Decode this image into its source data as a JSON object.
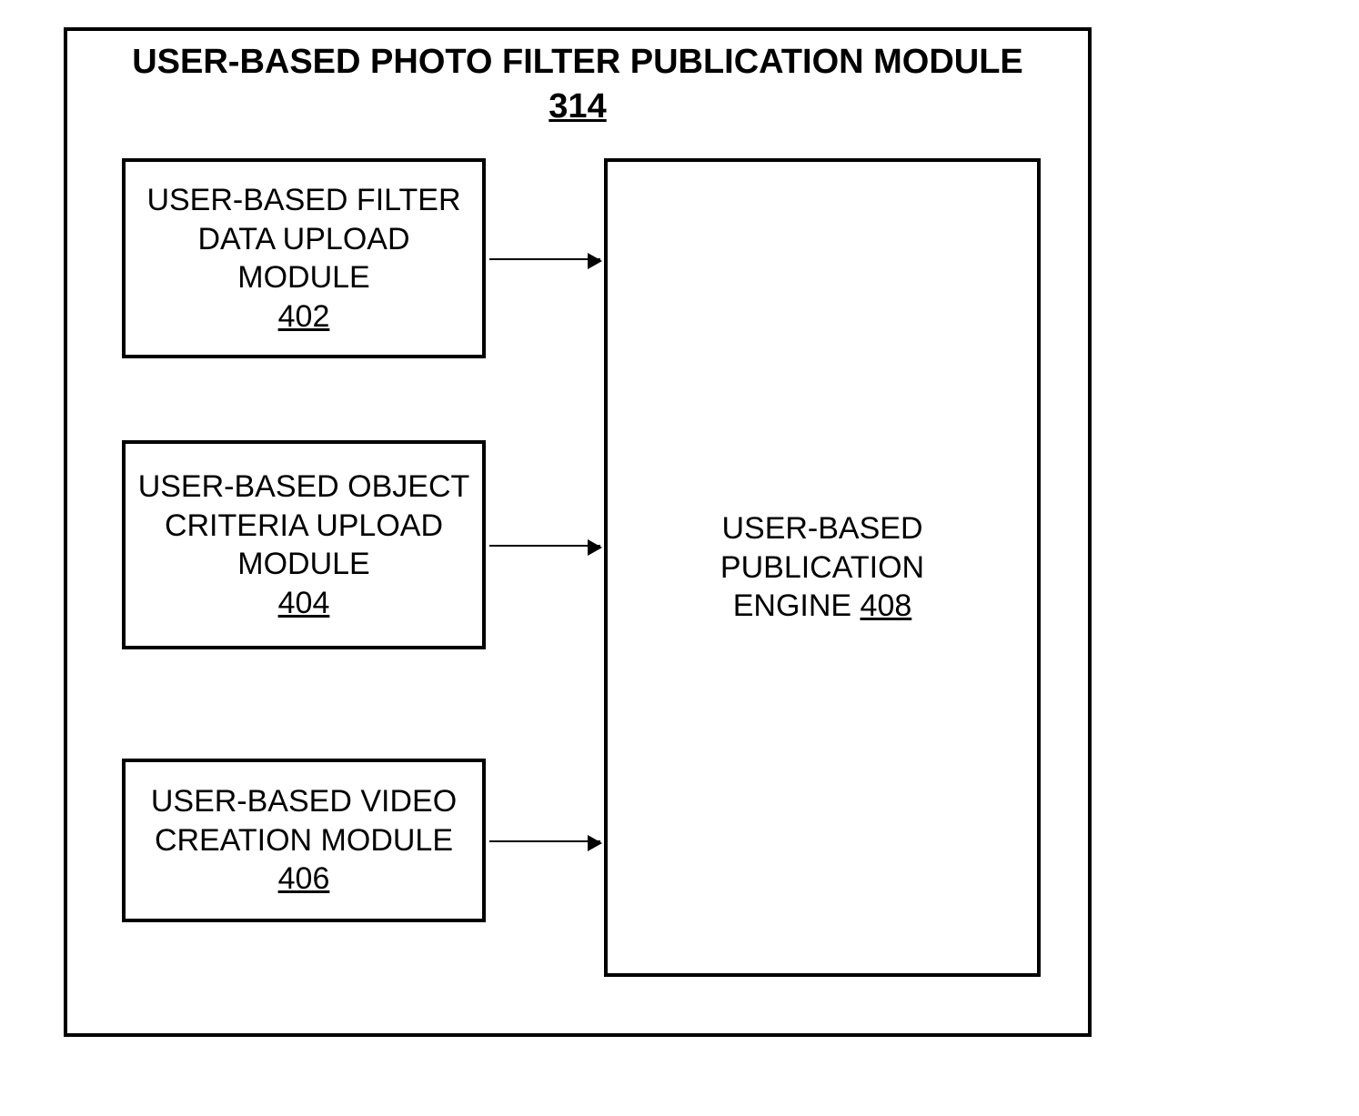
{
  "main": {
    "title": "USER-BASED PHOTO FILTER PUBLICATION MODULE",
    "ref": "314"
  },
  "boxes": {
    "upload_filter": {
      "text": "USER-BASED FILTER DATA UPLOAD MODULE",
      "ref": "402"
    },
    "upload_criteria": {
      "text": "USER-BASED OBJECT CRITERIA UPLOAD MODULE",
      "ref": "404"
    },
    "video_creation": {
      "text": "USER-BASED VIDEO CREATION MODULE",
      "ref": "406"
    },
    "pub_engine": {
      "text_line1": "USER-BASED",
      "text_line2": "PUBLICATION",
      "text_line3_prefix": "ENGINE ",
      "ref": "408"
    }
  }
}
